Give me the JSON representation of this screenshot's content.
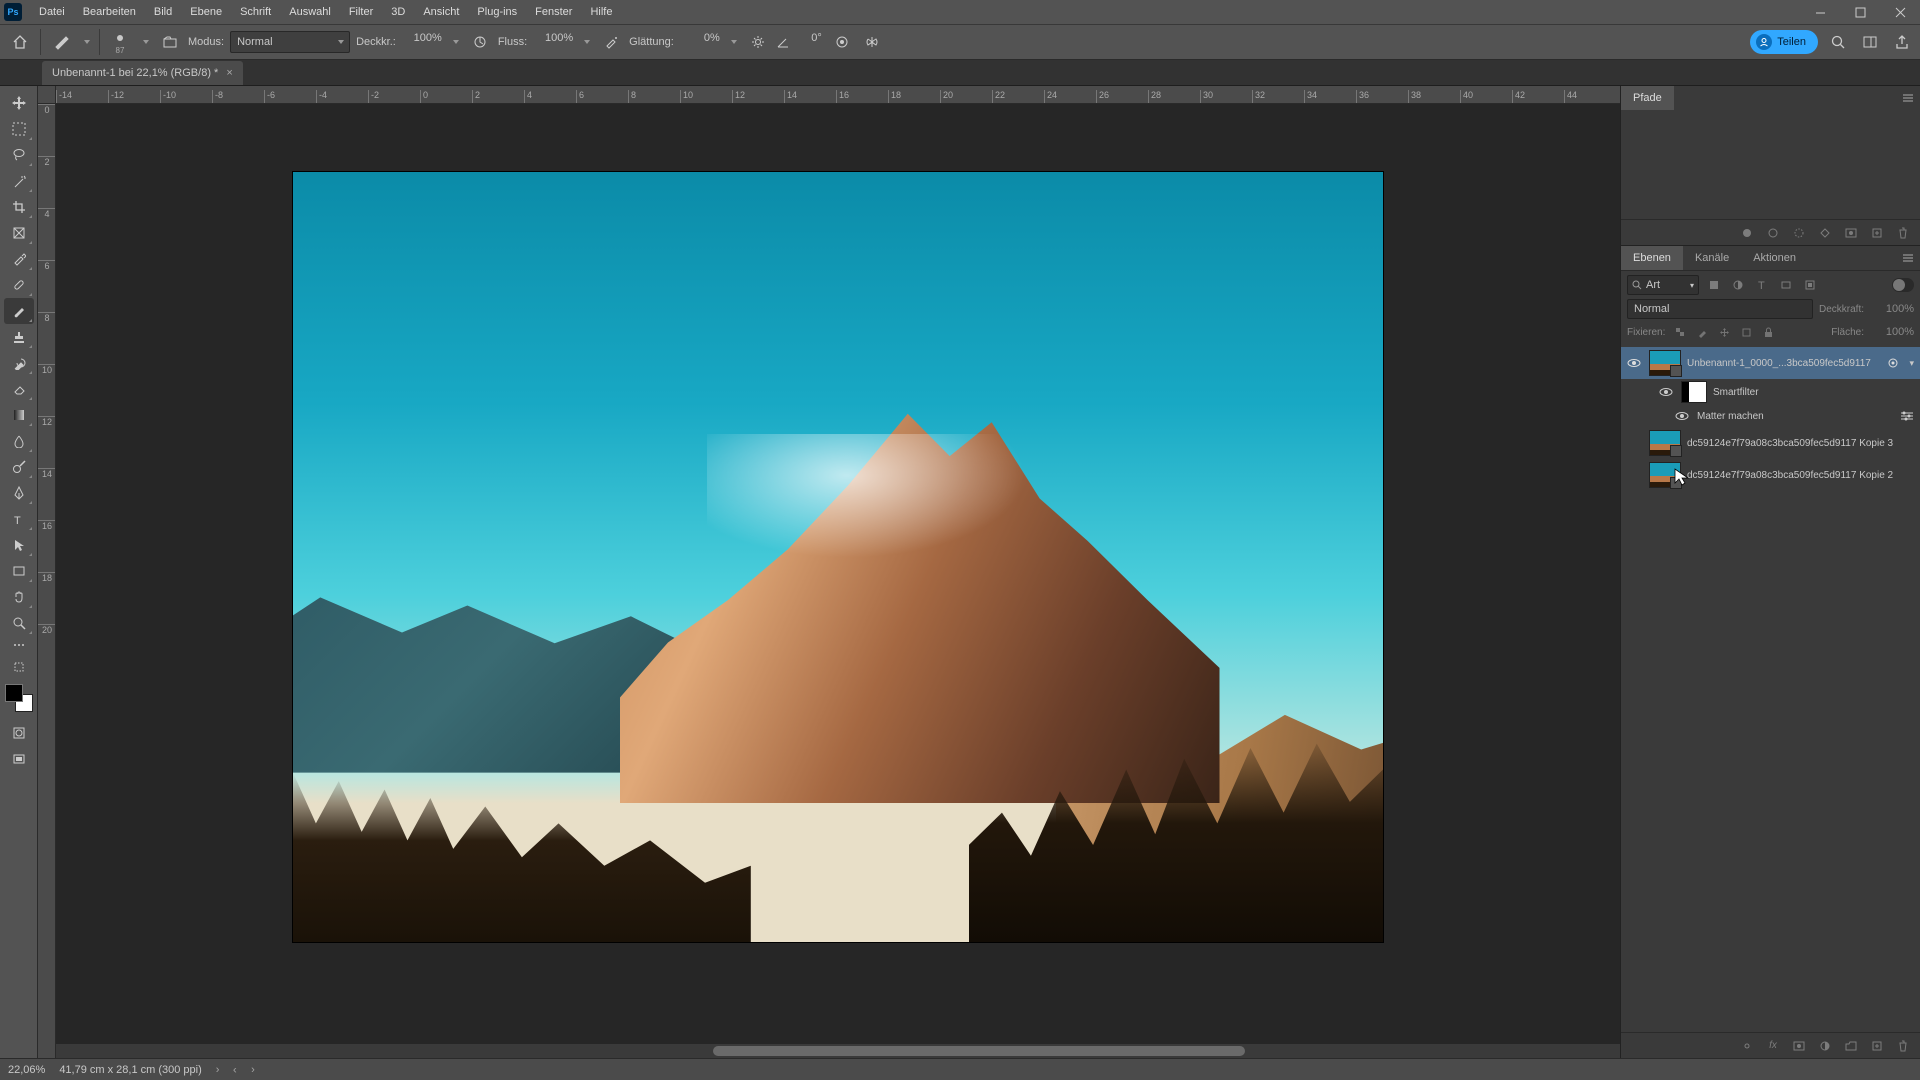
{
  "menubar": [
    "Datei",
    "Bearbeiten",
    "Bild",
    "Ebene",
    "Schrift",
    "Auswahl",
    "Filter",
    "3D",
    "Ansicht",
    "Plug-ins",
    "Fenster",
    "Hilfe"
  ],
  "options": {
    "brush_size": "87",
    "mode_label": "Modus:",
    "mode_value": "Normal",
    "opacity_label": "Deckkr.:",
    "opacity_value": "100%",
    "flow_label": "Fluss:",
    "flow_value": "100%",
    "smoothing_label": "Glättung:",
    "smoothing_value": "0%",
    "angle_value": "0°"
  },
  "share_label": "Teilen",
  "document_tab": "Unbenannt-1 bei 22,1% (RGB/8) *",
  "ruler_h": [
    "-14",
    "-12",
    "-10",
    "-8",
    "-6",
    "-4",
    "-2",
    "0",
    "2",
    "4",
    "6",
    "8",
    "10",
    "12",
    "14",
    "16",
    "18",
    "20",
    "22",
    "24",
    "26",
    "28",
    "30",
    "32",
    "34",
    "36",
    "38",
    "40",
    "42",
    "44"
  ],
  "ruler_v": [
    "0",
    "2",
    "4",
    "6",
    "8",
    "10",
    "12",
    "14",
    "16",
    "18",
    "20"
  ],
  "panels": {
    "pfade_tab": "Pfade",
    "layers_tabs": [
      "Ebenen",
      "Kanäle",
      "Aktionen"
    ],
    "filter_label": "Art",
    "blend_mode": "Normal",
    "opacity_label": "Deckkraft:",
    "opacity_value": "100%",
    "lock_label": "Fixieren:",
    "fill_label": "Fläche:",
    "fill_value": "100%"
  },
  "layers": [
    {
      "name": "Unbenannt-1_0000_...3bca509fec5d9117",
      "visible": true,
      "selected": true,
      "smart": true
    },
    {
      "name": "Smartfilter",
      "sub": true
    },
    {
      "name": "Matter machen",
      "sub2": true
    },
    {
      "name": "dc59124e7f79a08c3bca509fec5d9117 Kopie 3",
      "visible": false
    },
    {
      "name": "dc59124e7f79a08c3bca509fec5d9117 Kopie 2",
      "visible": false
    }
  ],
  "status": {
    "zoom": "22,06%",
    "docinfo": "41,79 cm x 28,1 cm (300 ppi)"
  }
}
